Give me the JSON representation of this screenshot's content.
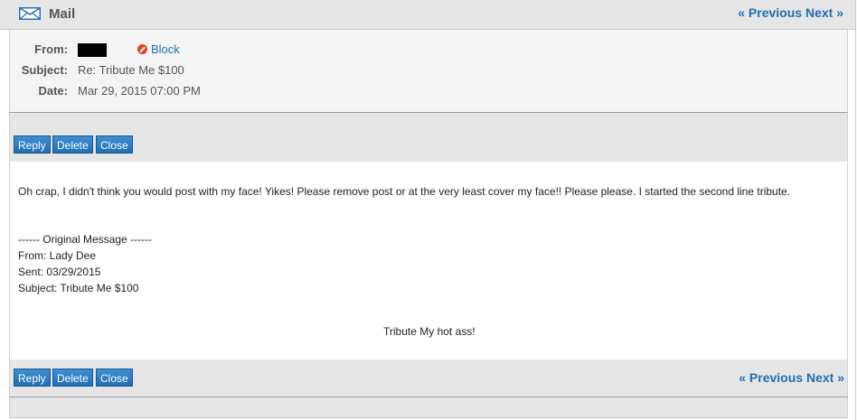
{
  "header": {
    "title": "Mail",
    "prev_label": "« Previous",
    "next_label": "Next »"
  },
  "meta": {
    "from_label": "From:",
    "block_label": "Block",
    "subject_label": "Subject:",
    "subject_value": "Re: Tribute Me $100",
    "date_label": "Date:",
    "date_value": "Mar 29, 2015 07:00 PM"
  },
  "toolbar": {
    "reply_label": "Reply",
    "delete_label": "Delete",
    "close_label": "Close"
  },
  "message": {
    "reply_text": "Oh crap, I didn't think you would post with my face! Yikes! Please remove post or at the very least cover my face!! Please please. I started the second line tribute.",
    "original_header": "------ Original Message ------",
    "orig_from": "From: Lady Dee",
    "orig_sent": "Sent: 03/29/2015",
    "orig_subject": "Subject: Tribute Me $100",
    "orig_body": "Tribute My hot ass!"
  },
  "icons": {
    "mail": "envelope-icon",
    "block": "block-icon"
  },
  "colors": {
    "link": "#1f6fb2",
    "button": "#1f6fb2",
    "block": "#e0451c"
  }
}
